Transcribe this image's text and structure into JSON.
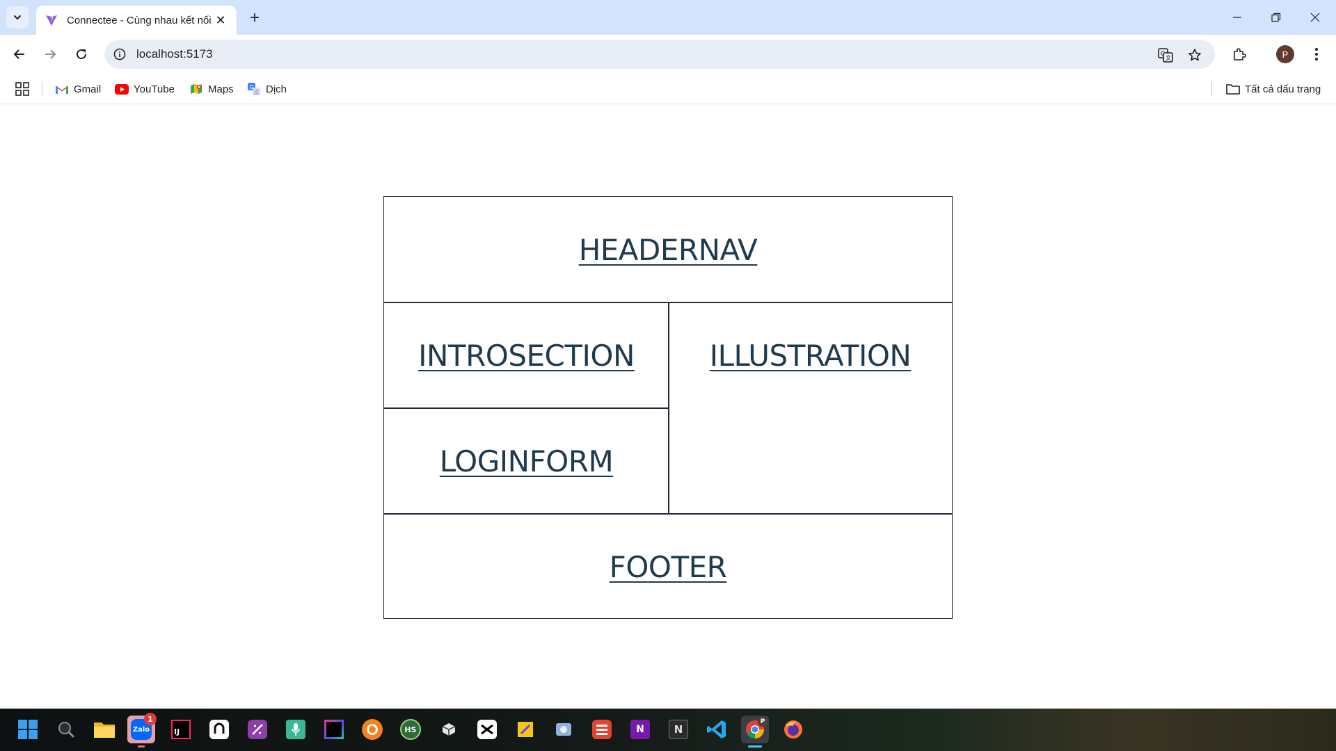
{
  "browser": {
    "tab": {
      "title": "Connectee - Cùng nhau kết nối",
      "favicon": "vite-icon",
      "close_icon": "close-icon"
    },
    "new_tab_label": "+",
    "window_controls": [
      "minimize-icon",
      "restore-icon",
      "close-icon"
    ],
    "toolbar": {
      "back_icon": "back-arrow-icon",
      "forward_icon": "forward-arrow-icon",
      "reload_icon": "reload-icon",
      "url": "localhost:5173",
      "site_info_icon": "info-icon",
      "translate_icon": "translate-icon",
      "bookmark_icon": "star-icon",
      "extensions_icon": "puzzle-icon",
      "profile_initial": "P",
      "menu_icon": "kebab-menu-icon"
    },
    "bookmarks": {
      "apps_icon": "apps-grid-icon",
      "items": [
        {
          "label": "Gmail",
          "icon": "gmail-icon"
        },
        {
          "label": "YouTube",
          "icon": "youtube-icon"
        },
        {
          "label": "Maps",
          "icon": "maps-icon"
        },
        {
          "label": "Dịch",
          "icon": "translate-icon"
        }
      ],
      "all_bookmarks": "Tất cả dấu trang"
    }
  },
  "page": {
    "sections": {
      "header": "HEADERNAV",
      "intro": "INTROSECTION",
      "illustration": "ILLUSTRATION",
      "login": "LOGINFORM",
      "footer": "FOOTER"
    }
  },
  "taskbar": {
    "zalo_badge": "1",
    "zalo_label": "Zalo",
    "intellij_label": "IJ",
    "hs_label": "HS",
    "onenote_label": "N",
    "notion_label": "N",
    "chrome_profile": "P",
    "apps": [
      "windows-start-icon",
      "search-icon",
      "file-explorer-icon",
      "zalo-icon",
      "intellij-icon",
      "app-icon",
      "app-icon",
      "voice-recorder-icon",
      "jetbrains-icon",
      "app-icon",
      "hs-icon",
      "app-icon",
      "capcut-icon",
      "app-icon",
      "app-icon",
      "todoist-icon",
      "onenote-icon",
      "notion-icon",
      "vscode-icon",
      "chrome-icon",
      "firefox-icon"
    ]
  }
}
